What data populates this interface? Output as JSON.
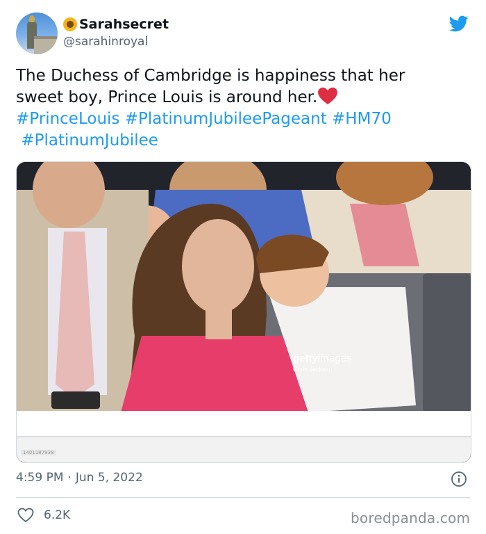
{
  "author": {
    "display_name": "Sarahsecret",
    "handle": "@sarahinroyal",
    "emoji_icon": "sunflower-icon",
    "avatar_icon": "palace-monument-avatar"
  },
  "tweet": {
    "text_line1": "The Duchess of Cambridge is happiness that her",
    "text_line2": "sweet boy, Prince Louis is around her.",
    "hashtags": [
      "#PrinceLouis",
      "#PlatinumJubileePageant",
      "#HM70",
      "#PlatinumJubilee"
    ],
    "heart_icon": "red-heart-icon"
  },
  "photo": {
    "credit_brand_left": "getty",
    "credit_brand_right": "images",
    "credit_photographer": "Chris Jackson",
    "image_id": "1401187938"
  },
  "meta": {
    "time": "4:59 PM",
    "separator": "·",
    "date": "Jun 5, 2022"
  },
  "engagement": {
    "likes": "6.2K"
  },
  "watermark": "boredpanda.com",
  "colors": {
    "link": "#1d9bf0",
    "text": "#0f1419",
    "secondary": "#536471",
    "twitter_blue": "#1d9bf0"
  }
}
